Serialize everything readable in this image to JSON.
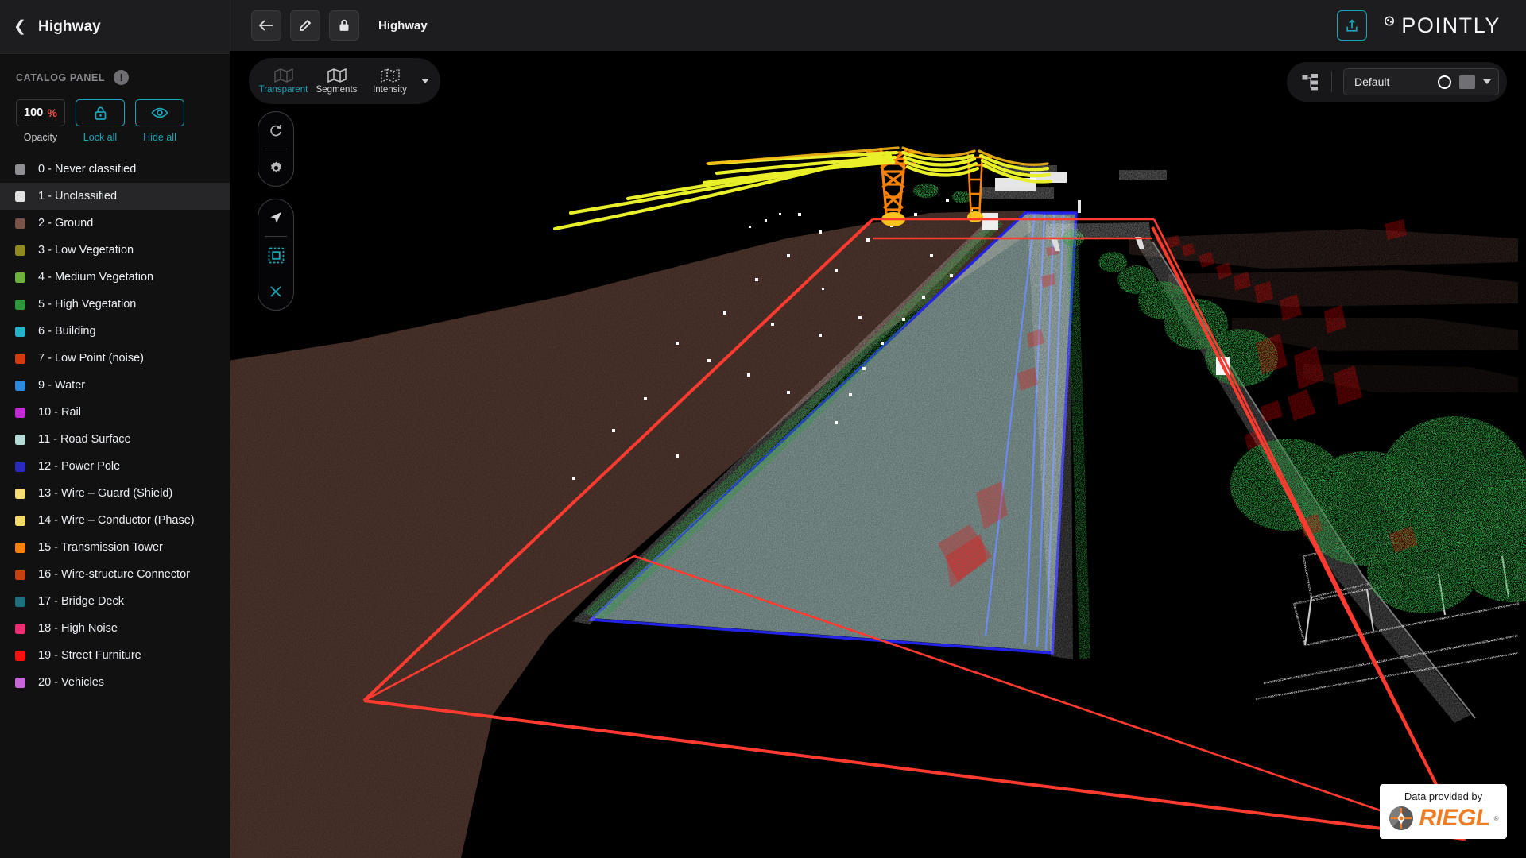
{
  "sidebar": {
    "project_title": "Highway",
    "back_icon": "chevron-left-icon",
    "catalog_label": "CATALOG PANEL",
    "info_icon": "info-icon",
    "controls": {
      "opacity_value": "100",
      "opacity_unit": "%",
      "opacity_caption": "Opacity",
      "lock_icon": "lock-icon",
      "lock_caption": "Lock all",
      "eye_icon": "eye-icon",
      "hide_caption": "Hide all"
    },
    "classes": [
      {
        "label": "0 - Never classified",
        "color": "#8f8f94",
        "selected": false
      },
      {
        "label": "1 - Unclassified",
        "color": "#e2e2e2",
        "selected": true
      },
      {
        "label": "2 - Ground",
        "color": "#7a5449",
        "selected": false
      },
      {
        "label": "3 - Low Vegetation",
        "color": "#8f8b21",
        "selected": false
      },
      {
        "label": "4 - Medium Vegetation",
        "color": "#6cb23c",
        "selected": false
      },
      {
        "label": "5 - High Vegetation",
        "color": "#2a9a3c",
        "selected": false
      },
      {
        "label": "6 - Building",
        "color": "#23b4cc",
        "selected": false
      },
      {
        "label": "7 - Low Point (noise)",
        "color": "#d43a10",
        "selected": false
      },
      {
        "label": "9 - Water",
        "color": "#2b8ae0",
        "selected": false
      },
      {
        "label": "10 - Rail",
        "color": "#c22ad4",
        "selected": false
      },
      {
        "label": "11 - Road Surface",
        "color": "#b5dbd6",
        "selected": false
      },
      {
        "label": "12 - Power Pole",
        "color": "#2a2abf",
        "selected": false
      },
      {
        "label": "13 - Wire – Guard (Shield)",
        "color": "#f6dd74",
        "selected": false
      },
      {
        "label": "14 - Wire – Conductor (Phase)",
        "color": "#f2d96b",
        "selected": false
      },
      {
        "label": "15 - Transmission Tower",
        "color": "#f88107",
        "selected": false
      },
      {
        "label": "16 - Wire-structure Connector",
        "color": "#c7400f",
        "selected": false
      },
      {
        "label": "17 - Bridge Deck",
        "color": "#1e6f7d",
        "selected": false
      },
      {
        "label": "18 - High Noise",
        "color": "#ef2b71",
        "selected": false
      },
      {
        "label": "19 - Street Furniture",
        "color": "#fb0f0f",
        "selected": false
      },
      {
        "label": "20 - Vehicles",
        "color": "#c766d6",
        "selected": false
      }
    ]
  },
  "topbar": {
    "back_icon": "arrow-left-icon",
    "edit_icon": "pencil-icon",
    "lock_icon": "lock-icon",
    "breadcrumb": "Highway",
    "share_icon": "share-upload-icon",
    "brand": "POINTLY"
  },
  "viewmode": {
    "tabs": [
      {
        "label": "Transparent",
        "icon": "map-fold-icon",
        "active": true
      },
      {
        "label": "Segments",
        "icon": "map-fold-solid-icon",
        "active": false
      },
      {
        "label": "Intensity",
        "icon": "map-fold-dotted-icon",
        "active": false
      }
    ],
    "caret_icon": "chevron-down-icon"
  },
  "renderstyle": {
    "tree_icon": "hierarchy-tree-icon",
    "selected": "Default",
    "ring_icon": "point-size-ring-icon",
    "swatch_icon": "color-chip-icon",
    "caret_icon": "chevron-down-icon"
  },
  "tools": {
    "group_a": [
      {
        "icon": "refresh-reset-icon",
        "active": false
      },
      {
        "icon": "gear-settings-icon",
        "active": false
      }
    ],
    "group_b": [
      {
        "icon": "navigate-cursor-icon",
        "active": false
      },
      {
        "icon": "box-select-icon",
        "active": true
      },
      {
        "icon": "close-clear-icon",
        "active": true
      }
    ]
  },
  "attribution": {
    "line1": "Data provided by",
    "brand": "RIEGL",
    "registered": "®",
    "logo_icon": "riegl-crosshair-logo"
  },
  "scene": {
    "description": "3D LiDAR point-cloud of a highway corridor with transmission line",
    "background": "#000000",
    "selection_color": "#ff3b30",
    "road_outline_color": "#2323e8",
    "ground_color": "#7a5449",
    "road_surface_color": "#b5dbd6",
    "wire_color": "#e9f02a",
    "tower_color": "#f88107",
    "vegetation_color": "#2a9a3c",
    "vehicle_color": "#fb0f0f",
    "structure_color": "#dcdcdc"
  }
}
